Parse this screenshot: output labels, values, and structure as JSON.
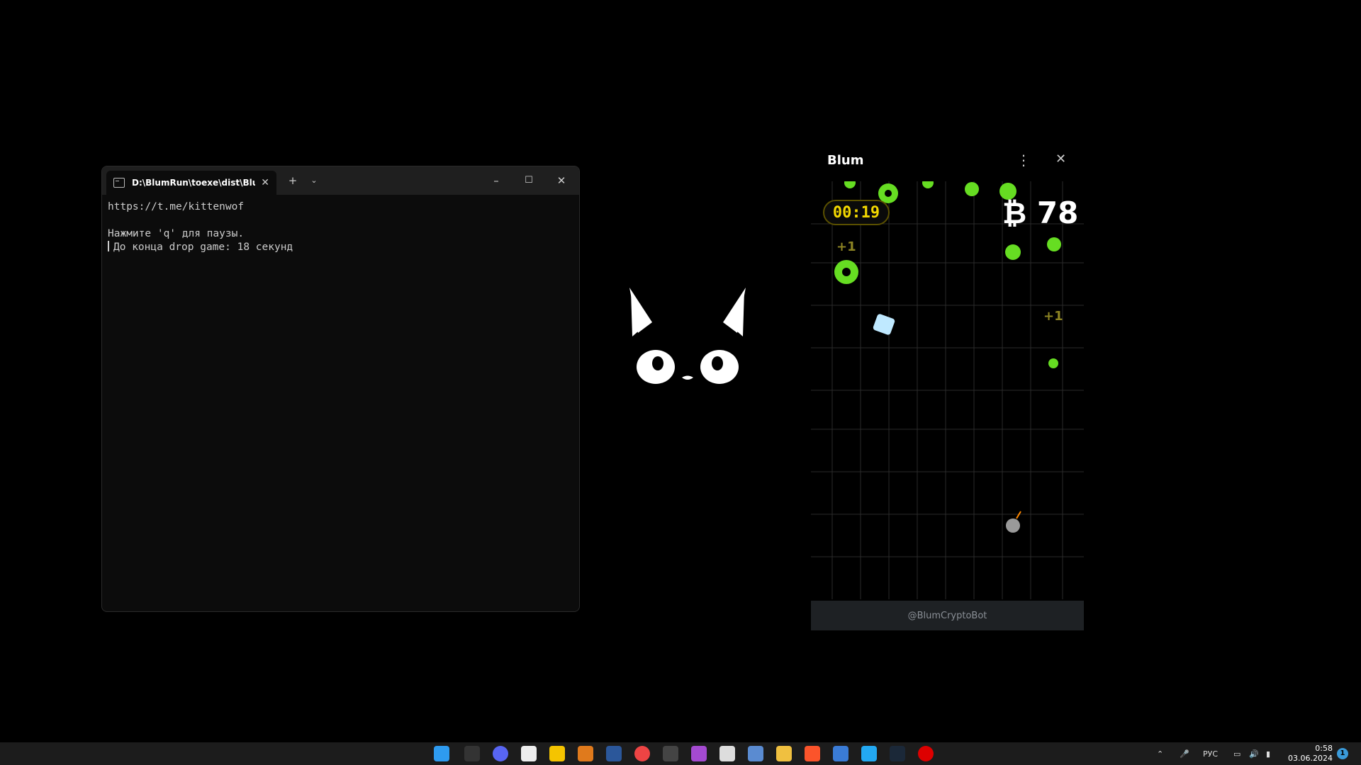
{
  "terminal": {
    "tab_title": "D:\\BlumRun\\toexe\\dist\\Bluml",
    "lines": [
      "https://t.me/kittenwof",
      "",
      "Нажмите 'q' для паузы.",
      "До конца drop game: 18 секунд"
    ]
  },
  "blum": {
    "title": "Blum",
    "timer": "00:19",
    "score": "₿ 78",
    "plus_one": "+1",
    "footer": "@BlumCryptoBot",
    "colors": {
      "timer": "#f2d700",
      "flower": "#66dd22",
      "footer_bg": "#1e2124"
    }
  },
  "taskbar": {
    "lang": "РУС",
    "time": "0:58",
    "date": "03.06.2024",
    "notification_count": "1"
  }
}
